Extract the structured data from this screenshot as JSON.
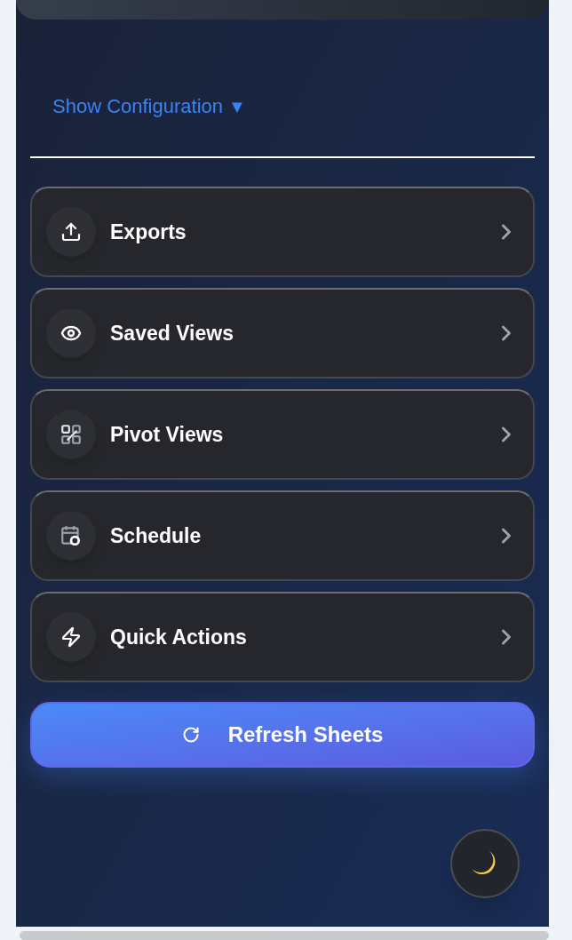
{
  "config_toggle": {
    "label": "Show Configuration",
    "caret": "▼"
  },
  "menu_items": [
    {
      "label": "Exports"
    },
    {
      "label": "Saved Views"
    },
    {
      "label": "Pivot Views"
    },
    {
      "label": "Schedule"
    },
    {
      "label": "Quick Actions"
    }
  ],
  "refresh_button": {
    "label": "Refresh Sheets"
  }
}
